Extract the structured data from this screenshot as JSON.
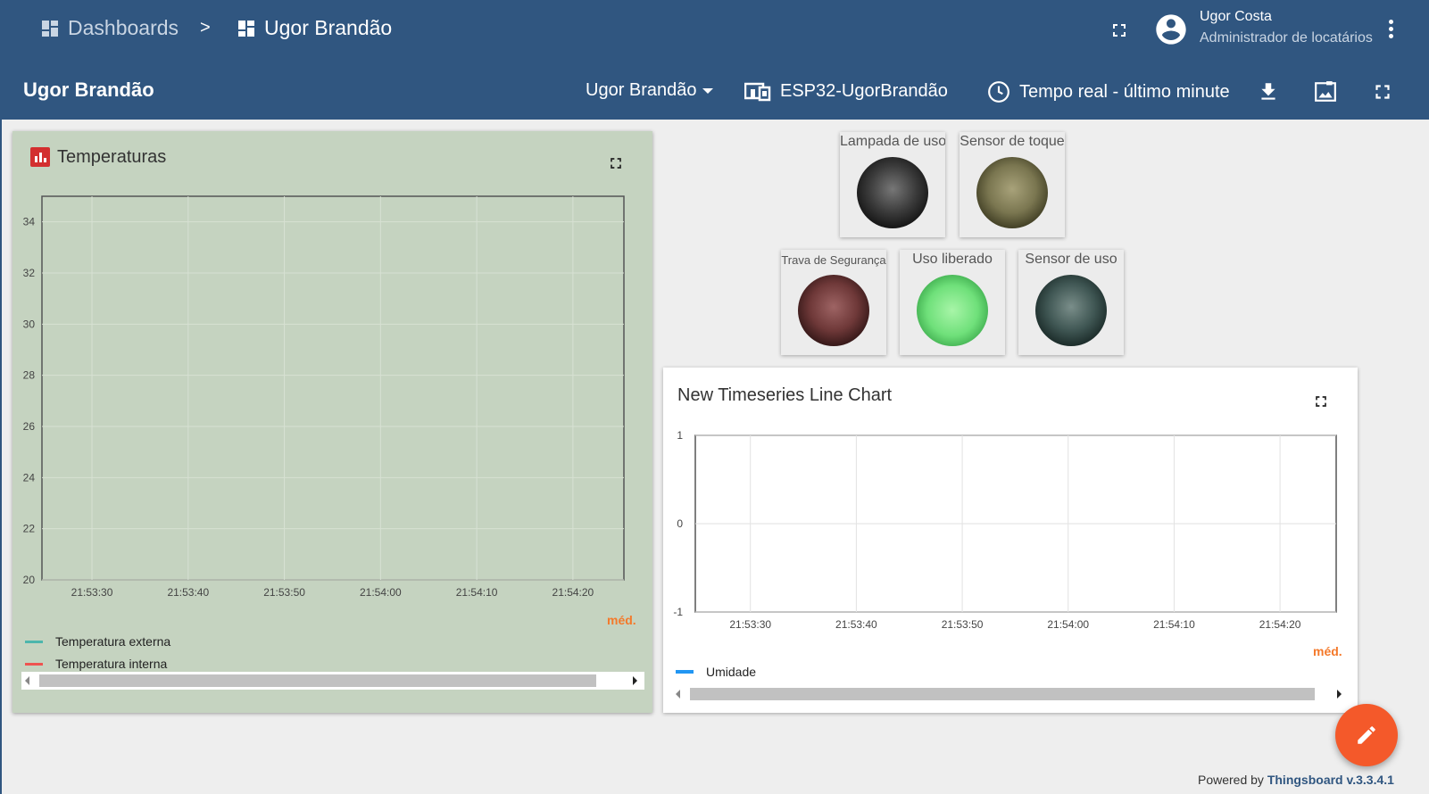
{
  "breadcrumb": {
    "root_label": "Dashboards",
    "separator": ">",
    "current_label": "Ugor Brandão"
  },
  "user": {
    "name": "Ugor Costa",
    "role": "Administrador de locatários"
  },
  "toolbar": {
    "dashboard_title": "Ugor Brandão",
    "state_label": "Ugor Brandão",
    "entity_label": "ESP32-UgorBrandão",
    "timewindow_label": "Tempo real - último minute"
  },
  "widgets": {
    "temperaturas": {
      "title": "Temperaturas",
      "aggregation": "méd.",
      "legend": [
        {
          "label": "Temperatura externa",
          "color": "#4db6ac"
        },
        {
          "label": "Temperatura interna",
          "color": "#ef5350"
        }
      ]
    },
    "leds": [
      {
        "label": "Lampada de uso",
        "state": "off",
        "color": "#3a3a3a"
      },
      {
        "label": "Sensor de toque",
        "state": "off",
        "color": "#7a7650"
      },
      {
        "label": "Trava de Segurança",
        "state": "off",
        "color": "#6e3838"
      },
      {
        "label": "Uso liberado",
        "state": "on",
        "color": "#6fe07a"
      },
      {
        "label": "Sensor de uso",
        "state": "off",
        "color": "#3f5653"
      }
    ],
    "timeseries": {
      "title": "New Timeseries Line Chart",
      "aggregation": "méd.",
      "legend": [
        {
          "label": "Umidade",
          "color": "#2196f3"
        }
      ]
    }
  },
  "chart_data": [
    {
      "type": "line",
      "title": "Temperaturas",
      "x": [
        "21:53:30",
        "21:53:40",
        "21:53:50",
        "21:54:00",
        "21:54:10",
        "21:54:20"
      ],
      "series": [
        {
          "name": "Temperatura externa",
          "values": []
        },
        {
          "name": "Temperatura interna",
          "values": []
        }
      ],
      "y_ticks": [
        20,
        22,
        24,
        26,
        28,
        30,
        32,
        34
      ],
      "ylim": [
        20,
        35
      ],
      "grid": true,
      "legend": "bottom-left"
    },
    {
      "type": "line",
      "title": "New Timeseries Line Chart",
      "x": [
        "21:53:30",
        "21:53:40",
        "21:53:50",
        "21:54:00",
        "21:54:10",
        "21:54:20"
      ],
      "series": [
        {
          "name": "Umidade",
          "values": []
        }
      ],
      "y_ticks": [
        -1,
        0,
        1
      ],
      "ylim": [
        -1,
        1
      ],
      "grid": true,
      "legend": "bottom-left"
    }
  ],
  "footer": {
    "powered_by": "Powered by",
    "brand": "Thingsboard v.3.3.4.1"
  },
  "colors": {
    "header": "#305680",
    "accent": "#f4592a",
    "widget1_bg": "#c5d3c0"
  }
}
